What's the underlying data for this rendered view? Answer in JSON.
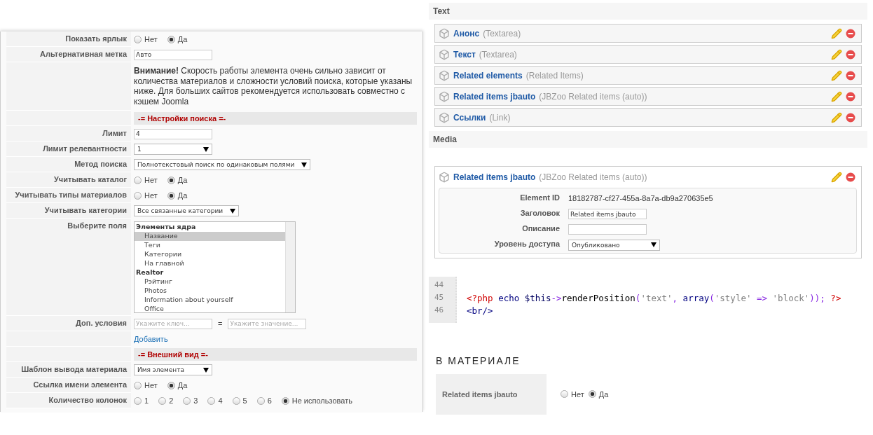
{
  "left_form": {
    "rows": [
      {
        "kind": "radio",
        "label": "Показать ярлык",
        "options": [
          {
            "label": "Нет",
            "selected": false
          },
          {
            "label": "Да",
            "selected": true
          }
        ]
      },
      {
        "kind": "input",
        "label": "Альтернативная метка",
        "value": "Авто"
      },
      {
        "kind": "note",
        "text": "**Внимание!** Скорость работы элемента очень сильно зависит от количества материалов и сложности условий поиска, которые указаны ниже. Для больших сайтов рекомендуется использовать совместно с кэшем Joomla"
      },
      {
        "kind": "section",
        "text": "-= Настройки поиска =-"
      },
      {
        "kind": "input",
        "label": "Лимит",
        "value": "4"
      },
      {
        "kind": "select",
        "label": "Лимит релевантности",
        "value": "1"
      },
      {
        "kind": "select",
        "label": "Метод поиска",
        "value": "Полнотекстовый поиск по одинаковым полями"
      },
      {
        "kind": "radio",
        "label": "Учитывать каталог",
        "options": [
          {
            "label": "Нет",
            "selected": false
          },
          {
            "label": "Да",
            "selected": true
          }
        ]
      },
      {
        "kind": "radio",
        "label": "Учитывать типы материалов",
        "options": [
          {
            "label": "Нет",
            "selected": false
          },
          {
            "label": "Да",
            "selected": true
          }
        ]
      },
      {
        "kind": "select",
        "label": "Учитывать категории",
        "value": "Все связанные категории"
      },
      {
        "kind": "listbox",
        "label": "Выберите поля",
        "groups": [
          {
            "label": "Элементы ядра",
            "items": [
              {
                "label": "Название",
                "selected": true
              },
              {
                "label": "Теги",
                "selected": false
              },
              {
                "label": "Категории",
                "selected": false
              },
              {
                "label": "На главной",
                "selected": false
              }
            ]
          },
          {
            "label": "Realtor",
            "items": [
              {
                "label": "Рэйтинг",
                "selected": false
              },
              {
                "label": "Photos",
                "selected": false
              },
              {
                "label": "Information about yourself",
                "selected": false
              },
              {
                "label": "Office",
                "selected": false
              }
            ]
          }
        ]
      },
      {
        "kind": "conditions",
        "label": "Доп. условия",
        "key_placeholder": "Укажите ключ...",
        "separator": "=",
        "value_placeholder": "Укажите значение..."
      },
      {
        "kind": "link",
        "text": "Добавить"
      },
      {
        "kind": "section",
        "text": "-= Внешний вид =-"
      },
      {
        "kind": "select",
        "label": "Шаблон вывода материала",
        "value": "Имя элемента"
      },
      {
        "kind": "radio",
        "label": "Ссылка имени элемента",
        "options": [
          {
            "label": "Нет",
            "selected": false
          },
          {
            "label": "Да",
            "selected": true
          }
        ]
      },
      {
        "kind": "radio",
        "label": "Количество колонок",
        "options": [
          {
            "label": "1",
            "selected": false
          },
          {
            "label": "2",
            "selected": false
          },
          {
            "label": "3",
            "selected": false
          },
          {
            "label": "4",
            "selected": false
          },
          {
            "label": "5",
            "selected": false
          },
          {
            "label": "6",
            "selected": false
          },
          {
            "label": "Не использовать",
            "selected": true
          }
        ]
      }
    ]
  },
  "element_groups": [
    {
      "title": "Text",
      "elements": [
        {
          "name": "Анонс",
          "type": "(Textarea)"
        },
        {
          "name": "Текст",
          "type": "(Textarea)"
        },
        {
          "name": "Related elements",
          "type": "(Related Items)"
        },
        {
          "name": "Related items jbauto",
          "type": "(JBZoo Related items (auto))"
        },
        {
          "name": "Ссылки",
          "type": "(Link)"
        }
      ]
    },
    {
      "title": "Media"
    }
  ],
  "element_card": {
    "name": "Related items jbauto",
    "type": "(JBZoo Related items (auto))",
    "fields": [
      {
        "kind": "text",
        "label": "Element ID",
        "value": "18182787-cf27-455a-8a7a-db9a270635e5"
      },
      {
        "kind": "input",
        "label": "Заголовок",
        "value": "Related items jbauto"
      },
      {
        "kind": "input",
        "label": "Описание"
      },
      {
        "kind": "select",
        "label": "Уровень доступа",
        "value": "Опубликовано"
      }
    ]
  },
  "code": {
    "lines": [
      {
        "number": "44"
      },
      {
        "number": "45",
        "tokens": [
          {
            "kind": "tag",
            "text": "<?php"
          },
          {
            "kind": "keyword",
            "text": " echo"
          },
          {
            "kind": "variable",
            "text": " $this"
          },
          {
            "kind": "punct",
            "text": "->"
          },
          {
            "kind": "plain",
            "text": "renderPosition"
          },
          {
            "kind": "punct",
            "text": "("
          },
          {
            "kind": "string",
            "text": "'text'"
          },
          {
            "kind": "punct",
            "text": ", "
          },
          {
            "kind": "keyword",
            "text": "array"
          },
          {
            "kind": "punct",
            "text": "("
          },
          {
            "kind": "string",
            "text": "'style'"
          },
          {
            "kind": "punct",
            "text": " => "
          },
          {
            "kind": "string",
            "text": "'block'"
          },
          {
            "kind": "punct",
            "text": "));"
          },
          {
            "kind": "tag",
            "text": " ?>"
          }
        ]
      },
      {
        "number": "46",
        "tokens": [
          {
            "kind": "keyword",
            "text": "<br/>"
          }
        ]
      }
    ]
  },
  "material": {
    "heading": "В МАТЕРИАЛЕ",
    "label": "Related items jbauto",
    "options": [
      {
        "label": "Нет",
        "selected": false
      },
      {
        "label": "Да",
        "selected": true
      }
    ]
  }
}
